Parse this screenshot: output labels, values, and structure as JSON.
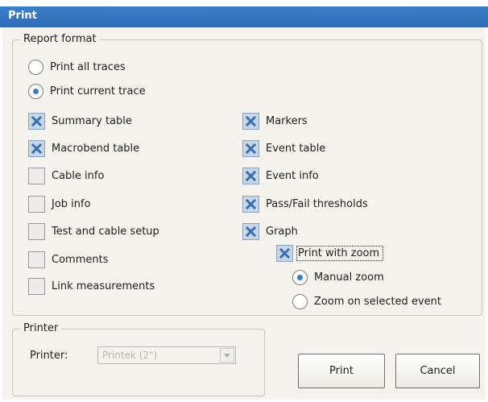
{
  "window": {
    "title": "Print"
  },
  "report_format": {
    "legend": "Report format",
    "trace_options": [
      {
        "label": "Print all traces",
        "selected": false
      },
      {
        "label": "Print current trace",
        "selected": true
      }
    ],
    "left_checkboxes": [
      {
        "label": "Summary table",
        "checked": true
      },
      {
        "label": "Macrobend table",
        "checked": true
      },
      {
        "label": "Cable info",
        "checked": false
      },
      {
        "label": "Job info",
        "checked": false
      },
      {
        "label": "Test and cable setup",
        "checked": false
      },
      {
        "label": "Comments",
        "checked": false
      },
      {
        "label": "Link measurements",
        "checked": false
      }
    ],
    "right_checkboxes": [
      {
        "label": "Markers",
        "checked": true
      },
      {
        "label": "Event table",
        "checked": true
      },
      {
        "label": "Event info",
        "checked": true
      },
      {
        "label": "Pass/Fail thresholds",
        "checked": true
      },
      {
        "label": "Graph",
        "checked": true
      }
    ],
    "print_with_zoom": {
      "label": "Print with zoom",
      "checked": true
    },
    "zoom_options": [
      {
        "label": "Manual zoom",
        "selected": true
      },
      {
        "label": "Zoom on selected event",
        "selected": false
      }
    ]
  },
  "printer": {
    "legend": "Printer",
    "label": "Printer:",
    "selected": "Printek (2\")"
  },
  "buttons": {
    "print": "Print",
    "cancel": "Cancel"
  },
  "colors": {
    "titlebar": "#2e6cb8",
    "check_fill": "#c7d7ea",
    "check_mark": "#3a6fb6",
    "radio_dot": "#3a78c8"
  }
}
